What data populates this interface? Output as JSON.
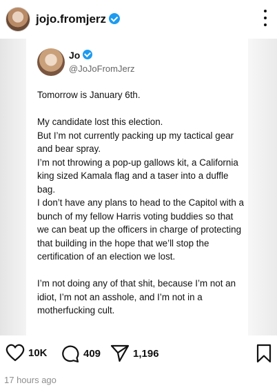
{
  "header": {
    "username": "jojo.fromjerz"
  },
  "tweet": {
    "name": "Jo",
    "handle": "@JoJoFromJerz",
    "paragraphs": [
      "Tomorrow is January 6th.",
      "My candidate lost this election.\nBut I’m not currently packing up my tactical gear and bear spray.\nI’m not throwing a pop-up gallows kit, a California king sized Kamala flag and a taser into a duffle bag.\nI don’t have any plans to head to the Capitol with a bunch of my fellow Harris voting buddies so that we can beat up the officers in charge of protecting that building in the hope that we’ll stop the certification of an election we lost.",
      "I’m not doing any of that shit, because I’m not an idiot, I’m not an asshole, and I’m not in a motherfucking cult."
    ]
  },
  "actions": {
    "likes": "10K",
    "comments": "409",
    "shares": "1,196"
  },
  "timestamp": "17 hours ago"
}
